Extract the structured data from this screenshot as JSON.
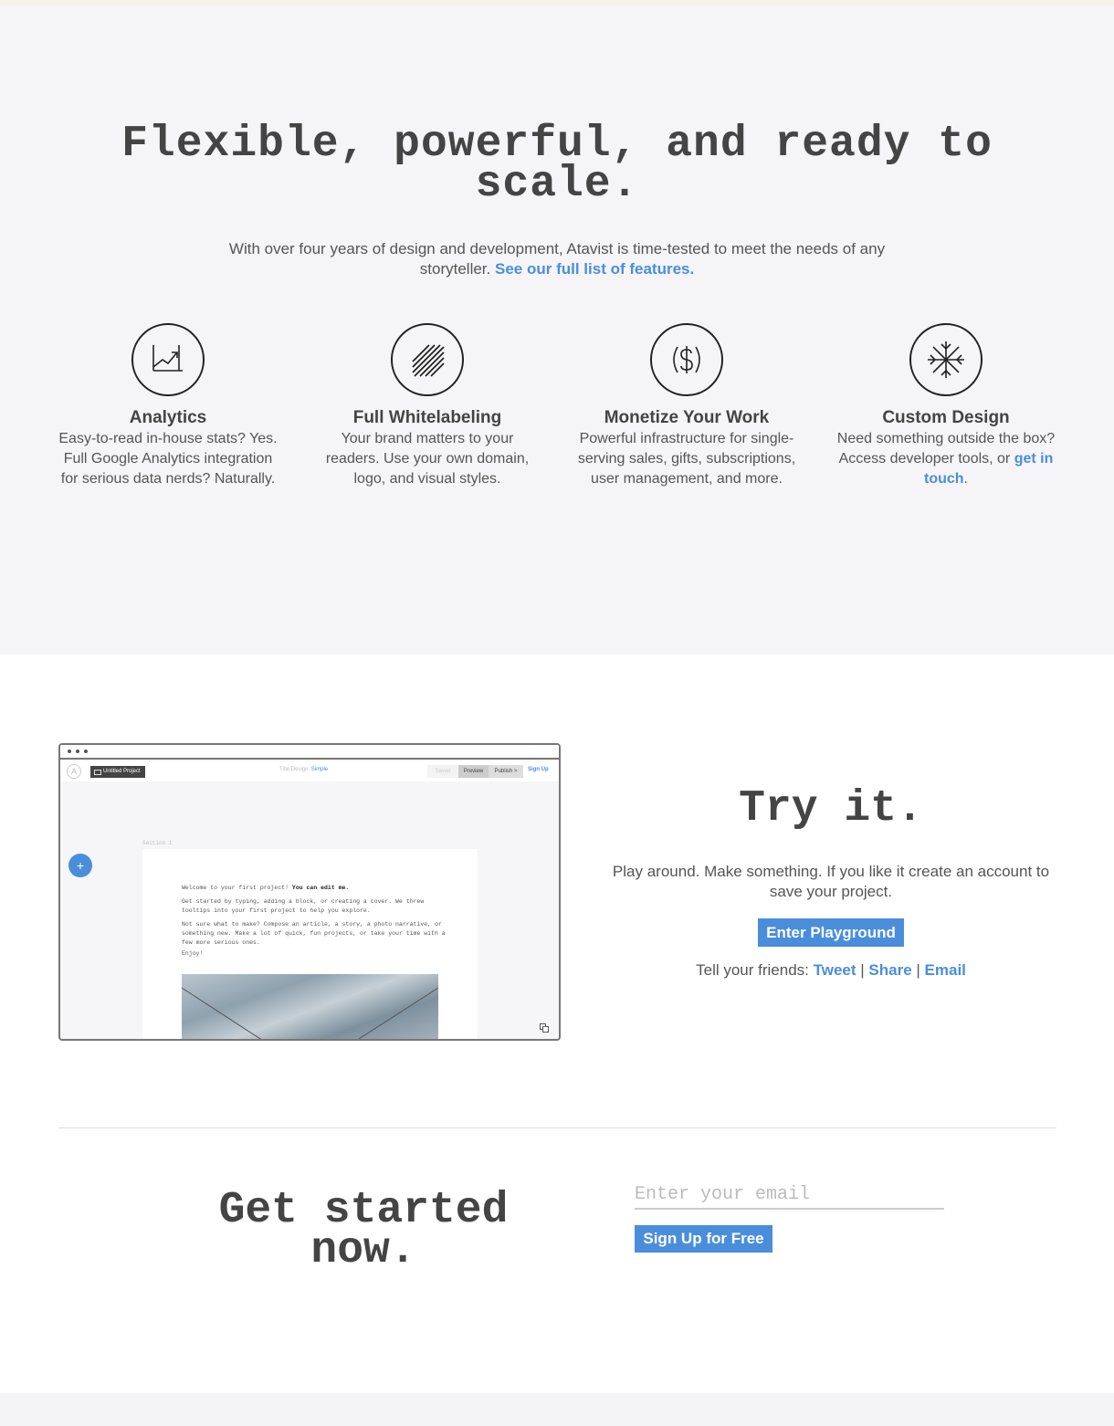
{
  "features_section": {
    "title": "Flexible, powerful, and ready to scale.",
    "subtitle": "With over four years of design and development, Atavist is time-tested to meet the needs of any storyteller.",
    "link": "See our full list of features.",
    "items": [
      {
        "icon": "analytics-chart-icon",
        "title": "Analytics",
        "desc": "Easy-to-read in-house stats? Yes. Full Google Analytics integration for serious data nerds? Naturally."
      },
      {
        "icon": "whitelabel-stripes-icon",
        "title": "Full Whitelabeling",
        "desc": "Your brand matters to your readers. Use your own domain, logo, and visual styles."
      },
      {
        "icon": "dollar-icon",
        "title": "Monetize Your Work",
        "desc": "Powerful infrastructure for single-serving sales, gifts, subscriptions, user management, and more."
      },
      {
        "icon": "snowflake-icon",
        "title": "Custom Design",
        "desc_before": "Need something outside the box? Access developer tools, or ",
        "desc_link": "get in touch",
        "desc_after": "."
      }
    ]
  },
  "editor_preview": {
    "project_name": "Untitled Project",
    "design_label": "Title Design: ",
    "design_value": "Simple",
    "saved": "Saved",
    "preview": "Preview",
    "publish": "Publish >",
    "signup": "Sign Up",
    "section_label": "Section 1",
    "add_symbol": "+",
    "welcome": "Welcome to your first project! ",
    "welcome_bold": "You can edit me.",
    "para1": "Get started by typing, adding a block, or creating a cover. We threw tooltips into your first project to help you explore.",
    "para2": "Not sure what to make? Compose an article, a story, a photo narrative, or something new. Make a lot of quick, fun projects, or take your time with a few more serious ones.",
    "para3": "Enjoy!"
  },
  "try_section": {
    "title": "Try it.",
    "desc": "Play around. Make something. If you like it create an account to save your project.",
    "button": "Enter Playground",
    "share_label": "Tell your friends: ",
    "share_links": [
      "Tweet",
      "Share",
      "Email"
    ],
    "separator": " | "
  },
  "cta_section": {
    "title": "Get started now.",
    "email_placeholder": "Enter your email",
    "button": "Sign Up for Free"
  },
  "colors": {
    "accent": "#4a8edb",
    "section_bg": "#f5f5f7",
    "text": "#4a4a4a"
  }
}
